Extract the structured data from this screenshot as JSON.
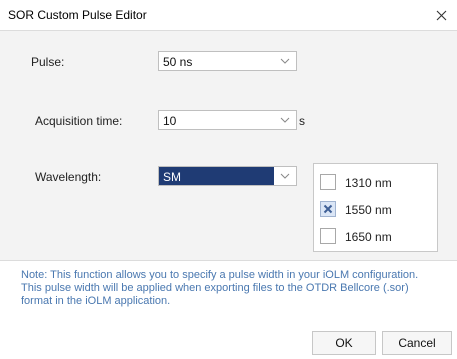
{
  "window": {
    "title": "SOR Custom Pulse Editor"
  },
  "icons": {
    "close": "close-icon",
    "dropdown": "chevron-down-icon",
    "check": "x-check-icon"
  },
  "form": {
    "pulse": {
      "label": "Pulse:",
      "value": "50 ns"
    },
    "acquisition": {
      "label": "Acquisition time:",
      "value": "10",
      "unit": "s"
    },
    "wavelength": {
      "label": "Wavelength:",
      "value": "SM"
    }
  },
  "wavelengths": [
    {
      "label": "1310 nm",
      "checked": false
    },
    {
      "label": "1550 nm",
      "checked": true
    },
    {
      "label": "1650 nm",
      "checked": false
    }
  ],
  "note": "Note: This function allows you to specify a pulse width in your iOLM configuration. This pulse width will be applied when exporting files to the OTDR Bellcore (.sor) format in the iOLM application.",
  "buttons": {
    "ok": "OK",
    "cancel": "Cancel"
  },
  "colors": {
    "selection": "#1f3b74",
    "note": "#4a78b0",
    "panel": "#f3f3f3"
  }
}
